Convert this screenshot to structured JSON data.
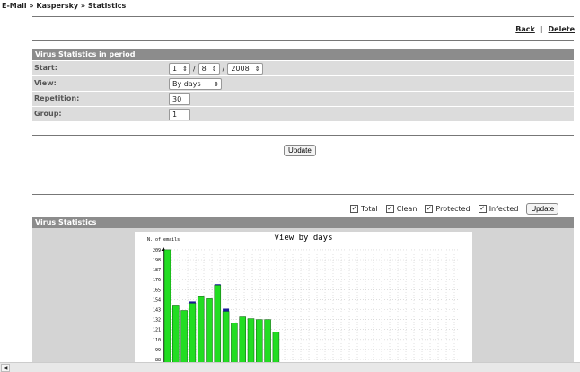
{
  "breadcrumb": "E-Mail » Kaspersky » Statistics",
  "links": {
    "back": "Back",
    "sep": "|",
    "delete": "Delete"
  },
  "period": {
    "header": "Virus Statistics in period",
    "start_label": "Start:",
    "start_day": "1",
    "start_sep": "/",
    "start_month": "8",
    "start_year": "2008",
    "view_label": "View:",
    "view_value": "By days",
    "repetition_label": "Repetition:",
    "repetition_value": "30",
    "group_label": "Group:",
    "group_value": "1"
  },
  "update_label": "Update",
  "filters": {
    "items": [
      "Total",
      "Clean",
      "Protected",
      "Infected"
    ],
    "update_label": "Update"
  },
  "stats": {
    "header": "Virus Statistics",
    "chart_data": {
      "type": "bar",
      "title": "View by days",
      "ylabel": "N. of emails",
      "yticks": [
        88,
        99,
        110,
        121,
        132,
        143,
        154,
        165,
        176,
        187,
        198,
        209
      ],
      "values_clean": [
        209,
        148,
        142,
        150,
        158,
        155,
        170,
        141,
        128,
        135,
        133,
        132,
        132,
        118
      ],
      "values_infected": [
        0,
        0,
        0,
        2,
        0,
        0,
        1,
        3,
        0,
        0,
        0,
        0,
        0,
        0
      ],
      "colors": {
        "clean": "#22dd22",
        "infected": "#1a1a99"
      }
    }
  }
}
